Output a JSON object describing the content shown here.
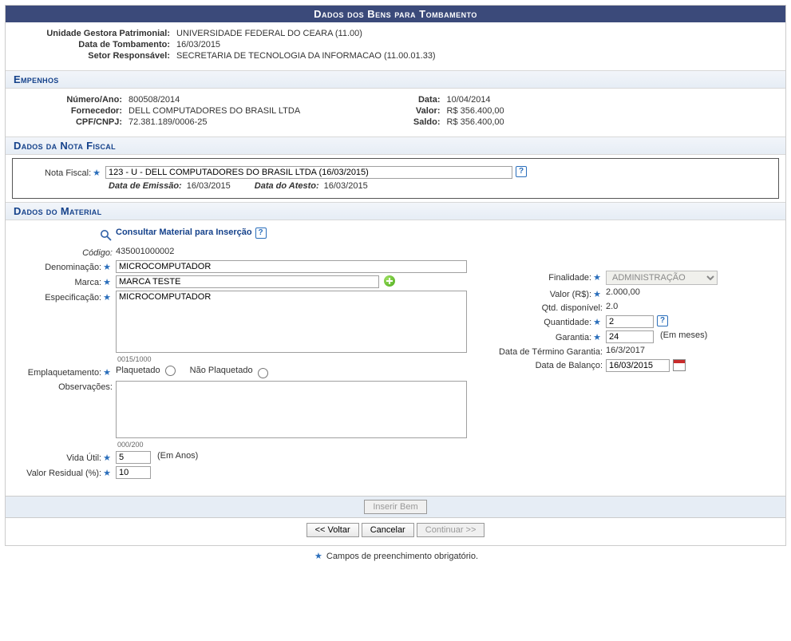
{
  "title": "Dados dos Bens para Tombamento",
  "top": {
    "unidade_label": "Unidade Gestora Patrimonial:",
    "unidade_value": "UNIVERSIDADE FEDERAL DO CEARA (11.00)",
    "data_tomb_label": "Data de Tombamento:",
    "data_tomb_value": "16/03/2015",
    "setor_label": "Setor Responsável:",
    "setor_value": "SECRETARIA DE TECNOLOGIA DA INFORMACAO (11.00.01.33)"
  },
  "empenhos": {
    "header": "Empenhos",
    "numero_label": "Número/Ano:",
    "numero_value": "800508/2014",
    "fornecedor_label": "Fornecedor:",
    "fornecedor_value": "DELL COMPUTADORES DO BRASIL LTDA",
    "cpf_label": "CPF/CNPJ:",
    "cpf_value": "72.381.189/0006-25",
    "data_label": "Data:",
    "data_value": "10/04/2014",
    "valor_label": "Valor:",
    "valor_value": "R$ 356.400,00",
    "saldo_label": "Saldo:",
    "saldo_value": "R$ 356.400,00"
  },
  "nota_fiscal": {
    "header": "Dados da Nota Fiscal",
    "nota_label": "Nota Fiscal:",
    "nota_value": "123 - U - DELL COMPUTADORES DO BRASIL LTDA (16/03/2015)",
    "emissao_label": "Data de Emissão:",
    "emissao_value": "16/03/2015",
    "atesto_label": "Data do Atesto:",
    "atesto_value": "16/03/2015"
  },
  "material": {
    "header": "Dados do Material",
    "consultar_link": "Consultar Material para Inserção",
    "codigo_label": "Código:",
    "codigo_value": "435001000002",
    "denominacao_label": "Denominação:",
    "denominacao_value": "MICROCOMPUTADOR",
    "marca_label": "Marca:",
    "marca_value": "MARCA TESTE",
    "espec_label": "Especificação:",
    "espec_value": "MICROCOMPUTADOR",
    "espec_counter": "0015/1000",
    "emplaq_label": "Emplaquetamento:",
    "emplaq_opt1": "Plaquetado",
    "emplaq_opt2": "Não Plaquetado",
    "obs_label": "Observações:",
    "obs_value": "",
    "obs_counter": "000/200",
    "vida_label": "Vida Útil:",
    "vida_value": "5",
    "vida_suffix": "(Em Anos)",
    "residual_label": "Valor Residual (%):",
    "residual_value": "10",
    "finalidade_label": "Finalidade:",
    "finalidade_value": "ADMINISTRAÇÃO",
    "valor_rs_label": "Valor (R$):",
    "valor_rs_value": "2.000,00",
    "qtd_disp_label": "Qtd. disponível:",
    "qtd_disp_value": "2.0",
    "quantidade_label": "Quantidade:",
    "quantidade_value": "2",
    "garantia_label": "Garantia:",
    "garantia_value": "24",
    "garantia_suffix": "(Em meses)",
    "data_termino_label": "Data de Término Garantia:",
    "data_termino_value": "16/3/2017",
    "data_balanco_label": "Data de Balanço:",
    "data_balanco_value": "16/03/2015"
  },
  "buttons": {
    "inserir": "Inserir Bem",
    "voltar": "<< Voltar",
    "cancelar": "Cancelar",
    "continuar": "Continuar >>"
  },
  "footnote": "Campos de preenchimento obrigatório."
}
